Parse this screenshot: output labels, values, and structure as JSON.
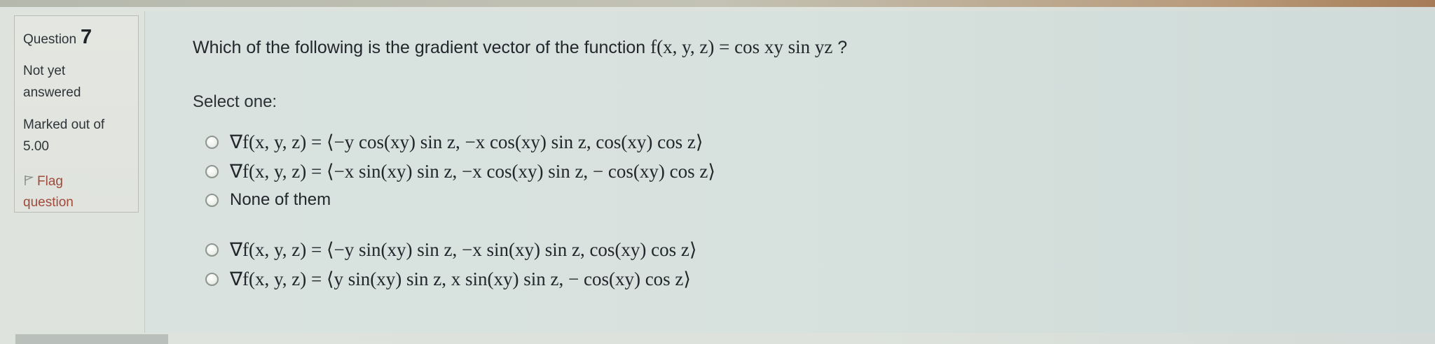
{
  "question": {
    "label": "Question",
    "number": "7",
    "status": "Not yet answered",
    "marked_out_of": "Marked out of 5.00",
    "flag_label": "Flag question",
    "text_prefix": "Which of the following is  the gradient vector of the function",
    "text_function": "f(x, y, z) = cos xy sin yz",
    "text_suffix": " ?",
    "select_label": "Select one:"
  },
  "options": [
    {
      "text": "∇f(x, y, z) = ⟨−y cos(xy) sin z, −x cos(xy) sin z, cos(xy) cos z⟩"
    },
    {
      "text": "∇f(x, y, z) = ⟨−x sin(xy) sin z, −x cos(xy) sin z, − cos(xy) cos z⟩"
    },
    {
      "text": "None of them"
    },
    {
      "text": "∇f(x, y, z) = ⟨−y sin(xy) sin z, −x sin(xy) sin z, cos(xy) cos z⟩"
    },
    {
      "text": "∇f(x, y, z) = ⟨y sin(xy) sin z, x sin(xy) sin z, − cos(xy) cos z⟩"
    }
  ],
  "icons": {
    "flag": "flag-icon",
    "radio": "radio-unchecked"
  },
  "colors": {
    "flag_text": "#a04a3a",
    "text": "#22272b",
    "panel_border": "#b9bdb6"
  }
}
